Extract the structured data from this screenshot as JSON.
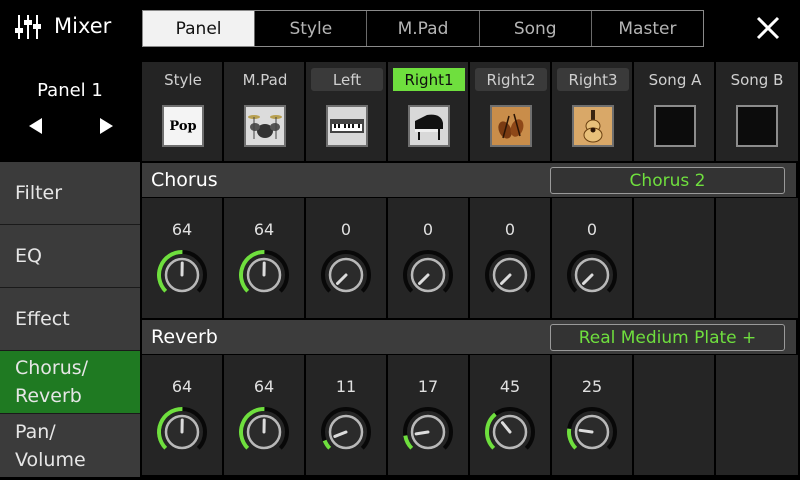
{
  "header": {
    "title": "Mixer",
    "app_icon": "mixer-sliders-icon",
    "tabs": [
      {
        "label": "Panel",
        "active": true
      },
      {
        "label": "Style",
        "active": false
      },
      {
        "label": "M.Pad",
        "active": false
      },
      {
        "label": "Song",
        "active": false
      },
      {
        "label": "Master",
        "active": false
      }
    ],
    "close_icon": "close-icon"
  },
  "panel": {
    "name": "Panel 1",
    "prev_icon": "triangle-left-icon",
    "next_icon": "triangle-right-icon"
  },
  "parts": [
    {
      "label": "Style",
      "state": "plain",
      "icon": "style-pop-icon",
      "icon_text": "Pop"
    },
    {
      "label": "M.Pad",
      "state": "plain",
      "icon": "drum-kit-icon"
    },
    {
      "label": "Left",
      "state": "boxed",
      "icon": "electric-piano-icon"
    },
    {
      "label": "Right1",
      "state": "active",
      "icon": "grand-piano-icon"
    },
    {
      "label": "Right2",
      "state": "boxed",
      "icon": "violins-icon"
    },
    {
      "label": "Right3",
      "state": "boxed",
      "icon": "acoustic-guitar-icon"
    },
    {
      "label": "Song A",
      "state": "plain",
      "icon": "empty-slot-icon"
    },
    {
      "label": "Song B",
      "state": "plain",
      "icon": "empty-slot-icon"
    }
  ],
  "menu": [
    {
      "label": "Filter",
      "active": false
    },
    {
      "label": "EQ",
      "active": false
    },
    {
      "label": "Effect",
      "active": false
    },
    {
      "label": "Chorus/\nReverb",
      "active": true
    },
    {
      "label": "Pan/\nVolume",
      "active": false
    }
  ],
  "chorus": {
    "title": "Chorus",
    "type": "Chorus 2",
    "values": [
      64,
      64,
      0,
      0,
      0,
      0
    ]
  },
  "reverb": {
    "title": "Reverb",
    "type": "Real Medium Plate +",
    "values": [
      64,
      64,
      11,
      17,
      45,
      25
    ]
  },
  "colors": {
    "accent_green": "#6fdf3e",
    "active_menu": "#1f7a22",
    "cell_bg": "#252525",
    "section_bg": "#3c3c3c"
  }
}
